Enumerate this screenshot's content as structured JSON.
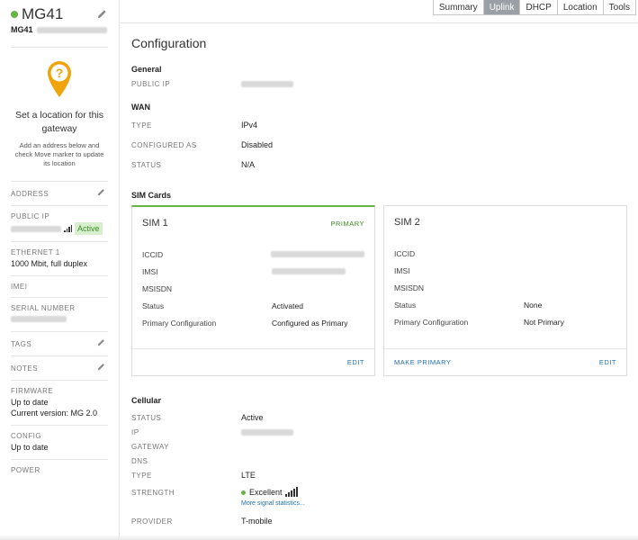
{
  "device": {
    "name": "MG41",
    "serial_prefix": "MG41"
  },
  "location": {
    "title": "Set a location for this gateway",
    "subtitle": "Add an address below and check Move marker to update its location"
  },
  "sidebar": {
    "address_label": "ADDRESS",
    "public_ip_label": "PUBLIC IP",
    "public_ip_status": "Active",
    "ethernet_label": "ETHERNET 1",
    "ethernet_value": "1000 Mbit, full duplex",
    "imei_label": "IMEI",
    "serial_label": "SERIAL NUMBER",
    "tags_label": "TAGS",
    "notes_label": "NOTES",
    "firmware_label": "FIRMWARE",
    "firmware_value1": "Up to date",
    "firmware_value2": "Current version: MG 2.0",
    "config_label": "CONFIG",
    "config_value": "Up to date",
    "power_label": "POWER"
  },
  "tabs": [
    "Summary",
    "Uplink",
    "DHCP",
    "Location",
    "Tools"
  ],
  "active_tab": "Uplink",
  "page_title": "Configuration",
  "general": {
    "heading": "General",
    "public_ip_label": "PUBLIC IP"
  },
  "wan": {
    "heading": "WAN",
    "rows": [
      {
        "k": "TYPE",
        "v": "IPv4"
      },
      {
        "k": "CONFIGURED AS",
        "v": "Disabled"
      },
      {
        "k": "STATUS",
        "v": "N/A"
      }
    ]
  },
  "sim_cards": {
    "heading": "SIM Cards",
    "sim1": {
      "title": "SIM 1",
      "tag": "PRIMARY",
      "iccid_label": "ICCID",
      "imsi_label": "IMSI",
      "msisdn_label": "MSISDN",
      "status_label": "Status",
      "status_value": "Activated",
      "primary_label": "Primary Configuration",
      "primary_value": "Configured as Primary",
      "edit_label": "EDIT"
    },
    "sim2": {
      "title": "SIM 2",
      "iccid_label": "ICCID",
      "imsi_label": "IMSI",
      "msisdn_label": "MSISDN",
      "status_label": "Status",
      "status_value": "None",
      "primary_label": "Primary Configuration",
      "primary_value": "Not Primary",
      "make_primary_label": "MAKE PRIMARY",
      "edit_label": "EDIT"
    }
  },
  "cellular": {
    "heading": "Cellular",
    "status_label": "STATUS",
    "status_value": "Active",
    "ip_label": "IP",
    "gateway_label": "GATEWAY",
    "dns_label": "DNS",
    "type_label": "TYPE",
    "type_value": "LTE",
    "strength_label": "STRENGTH",
    "strength_value": "Excellent",
    "more_link": "More signal statistics...",
    "provider_label": "PROVIDER",
    "provider_value": "T-mobile"
  },
  "colors": {
    "accent_green": "#67b346",
    "link_blue": "#1f6fa8",
    "pin_orange": "#f0a30a"
  }
}
